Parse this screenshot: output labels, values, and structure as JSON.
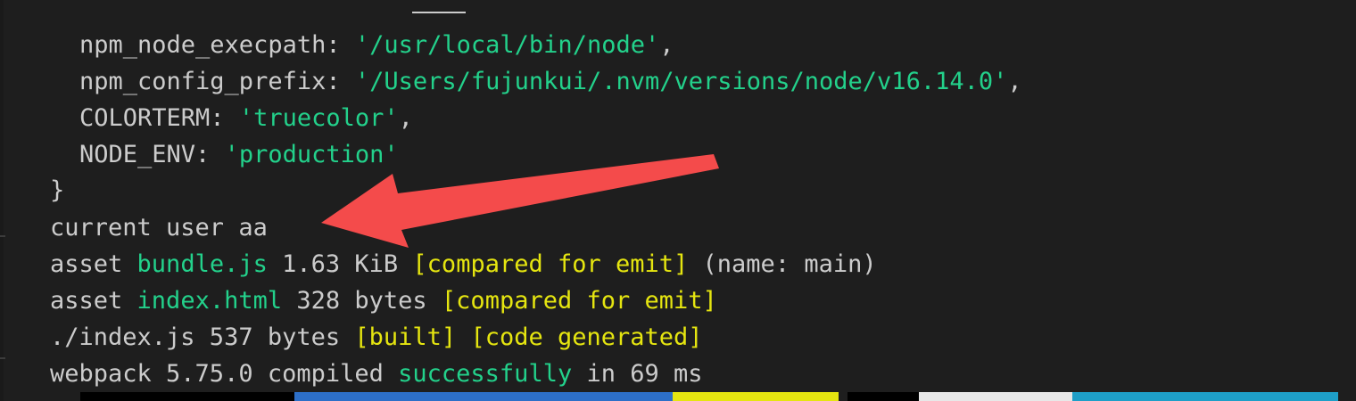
{
  "colors": {
    "background": "#1e1e1e",
    "default_text": "#cccccc",
    "string_green": "#23d18b",
    "highlight_yellow": "#e5e510",
    "annotation_arrow": "#f44b4b"
  },
  "terminal": {
    "lines": {
      "l1_key": "npm_node_execpath",
      "l1_sep": ": ",
      "l1_val": "'/usr/local/bin/node'",
      "l1_end": ",",
      "l2_key": "npm_config_prefix",
      "l2_sep": ": ",
      "l2_val": "'/Users/fujunkui/.nvm/versions/node/v16.14.0'",
      "l2_end": ",",
      "l3_key": "COLORTERM",
      "l3_sep": ": ",
      "l3_val": "'truecolor'",
      "l3_end": ",",
      "l4_key": "NODE_ENV",
      "l4_sep": ": ",
      "l4_val": "'production'",
      "l5": "}",
      "l6": "current user aa",
      "l7_a": "asset ",
      "l7_b": "bundle.js",
      "l7_c": " 1.63 KiB ",
      "l7_d": "[compared for emit]",
      "l7_e": " (name: main)",
      "l8_a": "asset ",
      "l8_b": "index.html",
      "l8_c": " 328 bytes ",
      "l8_d": "[compared for emit]",
      "l9_a": "./index.js 537 bytes ",
      "l9_b": "[built]",
      "l9_c": " ",
      "l9_d": "[code generated]",
      "l10_a": "webpack 5.75.0 compiled ",
      "l10_b": "successfully",
      "l10_c": " in 69 ms"
    }
  },
  "prompt_bar": {
    "segment_colors": [
      "#000000",
      "#2d6fc8",
      "#e5e510",
      "#000000",
      "#e8e8e8",
      "#1e9fc8"
    ]
  }
}
